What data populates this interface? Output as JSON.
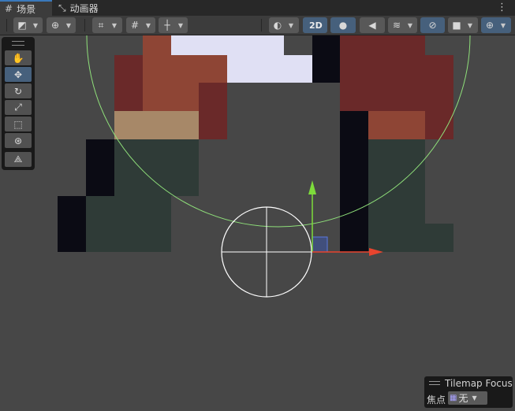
{
  "tabs": [
    {
      "label": "场景",
      "icon": "grid-icon",
      "active": true
    },
    {
      "label": "动画器",
      "icon": "animator-icon",
      "active": false
    }
  ],
  "toolbar": {
    "mode_2d_label": "2D",
    "icons": [
      "draw-mode-icon",
      "global-icon",
      "grid-snap-icon",
      "increment-snap-icon",
      "ruler-icon",
      "shading-icon",
      "lighting-icon",
      "audio-mute-icon",
      "effects-icon",
      "hidden-objects-icon",
      "camera-icon",
      "gizmo-icon"
    ]
  },
  "tools": [
    "hand-tool-icon",
    "move-tool-icon",
    "rotate-tool-icon",
    "scale-tool-icon",
    "rect-tool-icon",
    "transform-tool-icon",
    "custom-tool-icon"
  ],
  "selected_tool": "move",
  "tilemap_focus": {
    "title": "Tilemap Focus",
    "label": "焦点",
    "value": "无"
  },
  "colors": {
    "background": "#474747",
    "tab_bar": "#282828",
    "toolbar": "#3c3c3c",
    "accent_blue": "#46607c",
    "gizmo_x": "#e8442e",
    "gizmo_y": "#7ddb3b",
    "collider_circle": "#8fe07a"
  }
}
